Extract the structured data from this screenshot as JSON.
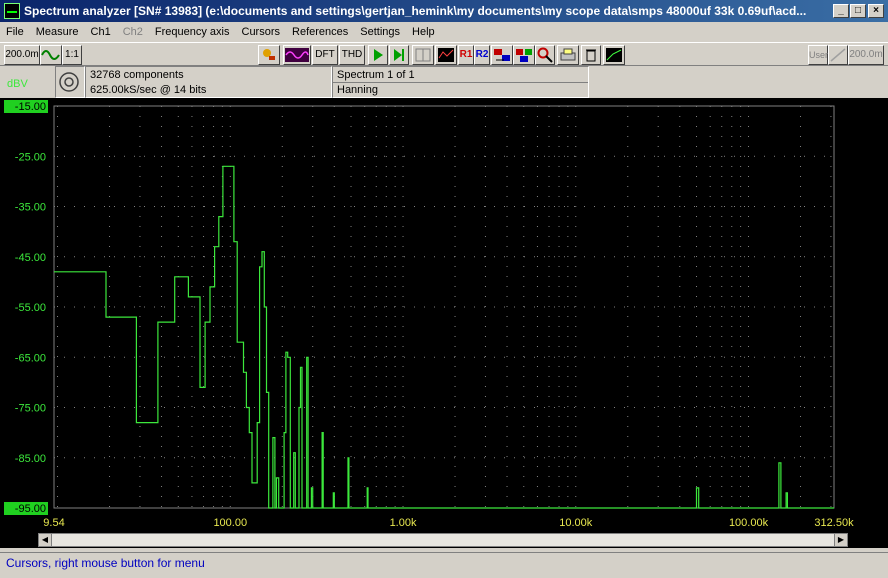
{
  "window": {
    "title": "Spectrum analyzer  [SN# 13983]  (e:\\documents and settings\\gertjan_hemink\\my documents\\my scope data\\smps 48000uf 33k 0.69uf\\acd..."
  },
  "menu": [
    "File",
    "Measure",
    "Ch1",
    "Ch2",
    "Frequency axis",
    "Cursors",
    "References",
    "Settings",
    "Help"
  ],
  "toolbar": {
    "left_range": "200.0m",
    "ratio": "1:1",
    "dft": "DFT",
    "thd": "THD",
    "r1": "R1",
    "r2": "R2",
    "user": "User",
    "right_range": "200.0m"
  },
  "info": {
    "components": "32768 components",
    "sample_rate": "625.00kS/sec @ 14 bits",
    "spectrum": "Spectrum 1 of 1",
    "window": "Hanning"
  },
  "status": "Cursors, right mouse button for menu",
  "chart_data": {
    "type": "line",
    "ylabel": "dBV",
    "ylim": [
      -95,
      -15
    ],
    "yticks": [
      "-15.00",
      "-25.00",
      "-35.00",
      "-45.00",
      "-55.00",
      "-65.00",
      "-75.00",
      "-85.00",
      "-95.00"
    ],
    "xscale": "log",
    "xlim": [
      9.54,
      312500
    ],
    "xticks": [
      {
        "label": "9.54",
        "value": 9.54
      },
      {
        "label": "100.00",
        "value": 100
      },
      {
        "label": "1.00k",
        "value": 1000
      },
      {
        "label": "10.00k",
        "value": 10000
      },
      {
        "label": "100.00k",
        "value": 100000
      },
      {
        "label": "312.50k",
        "value": 312500
      }
    ],
    "grid": true,
    "color": "#3ce83c",
    "series": [
      {
        "values": [
          [
            9.54,
            -48
          ],
          [
            19.07,
            -48
          ],
          [
            19.07,
            -57
          ],
          [
            28.6,
            -57
          ],
          [
            28.6,
            -78
          ],
          [
            38.1,
            -78
          ],
          [
            38.1,
            -58
          ],
          [
            47.7,
            -58
          ],
          [
            47.7,
            -49
          ],
          [
            57.2,
            -49
          ],
          [
            57.2,
            -53
          ],
          [
            66.8,
            -53
          ],
          [
            66.8,
            -71
          ],
          [
            71.5,
            -71
          ],
          [
            71.5,
            -58
          ],
          [
            76.3,
            -58
          ],
          [
            76.3,
            -51
          ],
          [
            81.1,
            -51
          ],
          [
            81.1,
            -43
          ],
          [
            85.8,
            -43
          ],
          [
            85.8,
            -37
          ],
          [
            90.6,
            -37
          ],
          [
            90.6,
            -27
          ],
          [
            104.9,
            -27
          ],
          [
            104.9,
            -42
          ],
          [
            109.7,
            -42
          ],
          [
            109.7,
            -62
          ],
          [
            119.2,
            -62
          ],
          [
            119.2,
            -68
          ],
          [
            124.0,
            -68
          ],
          [
            124.0,
            -75
          ],
          [
            128.8,
            -75
          ],
          [
            128.8,
            -80
          ],
          [
            133.5,
            -80
          ],
          [
            133.5,
            -90
          ],
          [
            143.1,
            -90
          ],
          [
            143.1,
            -78
          ],
          [
            147.8,
            -78
          ],
          [
            147.8,
            -47
          ],
          [
            152.6,
            -47
          ],
          [
            152.6,
            -44
          ],
          [
            157.4,
            -44
          ],
          [
            157.4,
            -55
          ],
          [
            162.1,
            -55
          ],
          [
            162.1,
            -72
          ],
          [
            166.9,
            -72
          ],
          [
            166.9,
            -95
          ],
          [
            176.4,
            -95
          ],
          [
            176.4,
            -81
          ],
          [
            181.2,
            -81
          ],
          [
            181.2,
            -95
          ],
          [
            185.0,
            -95
          ],
          [
            185.0,
            -89
          ],
          [
            190.7,
            -89
          ],
          [
            190.7,
            -95
          ],
          [
            205.0,
            -95
          ],
          [
            205.0,
            -80
          ],
          [
            210.0,
            -80
          ],
          [
            210.0,
            -64
          ],
          [
            215.0,
            -64
          ],
          [
            215.0,
            -65
          ],
          [
            222.5,
            -65
          ],
          [
            222.5,
            -95
          ],
          [
            233.0,
            -95
          ],
          [
            233.0,
            -84
          ],
          [
            238.0,
            -84
          ],
          [
            238.0,
            -95
          ],
          [
            250.0,
            -95
          ],
          [
            250.0,
            -75
          ],
          [
            255.0,
            -75
          ],
          [
            255.0,
            -67
          ],
          [
            260.0,
            -67
          ],
          [
            260.0,
            -95
          ],
          [
            277.0,
            -95
          ],
          [
            277.0,
            -65
          ],
          [
            282.0,
            -65
          ],
          [
            282.0,
            -95
          ],
          [
            295.0,
            -95
          ],
          [
            295.0,
            -91
          ],
          [
            300.0,
            -91
          ],
          [
            300.0,
            -95
          ],
          [
            340.0,
            -95
          ],
          [
            340.0,
            -80
          ],
          [
            345.0,
            -80
          ],
          [
            345.0,
            -95
          ],
          [
            395.0,
            -95
          ],
          [
            395.0,
            -92
          ],
          [
            400.0,
            -92
          ],
          [
            400.0,
            -95
          ],
          [
            480.0,
            -95
          ],
          [
            480.0,
            -85
          ],
          [
            486.0,
            -85
          ],
          [
            486.0,
            -95
          ],
          [
            620.0,
            -95
          ],
          [
            620.0,
            -91
          ],
          [
            627.0,
            -91
          ],
          [
            627.0,
            -95
          ],
          [
            50000,
            -95
          ],
          [
            50000,
            -91
          ],
          [
            51500,
            -91
          ],
          [
            51500,
            -95
          ],
          [
            150000,
            -95
          ],
          [
            150000,
            -86
          ],
          [
            154000,
            -86
          ],
          [
            154000,
            -95
          ],
          [
            165000,
            -95
          ],
          [
            165000,
            -92
          ],
          [
            168000,
            -92
          ],
          [
            168000,
            -95
          ],
          [
            312500,
            -95
          ]
        ]
      }
    ]
  }
}
